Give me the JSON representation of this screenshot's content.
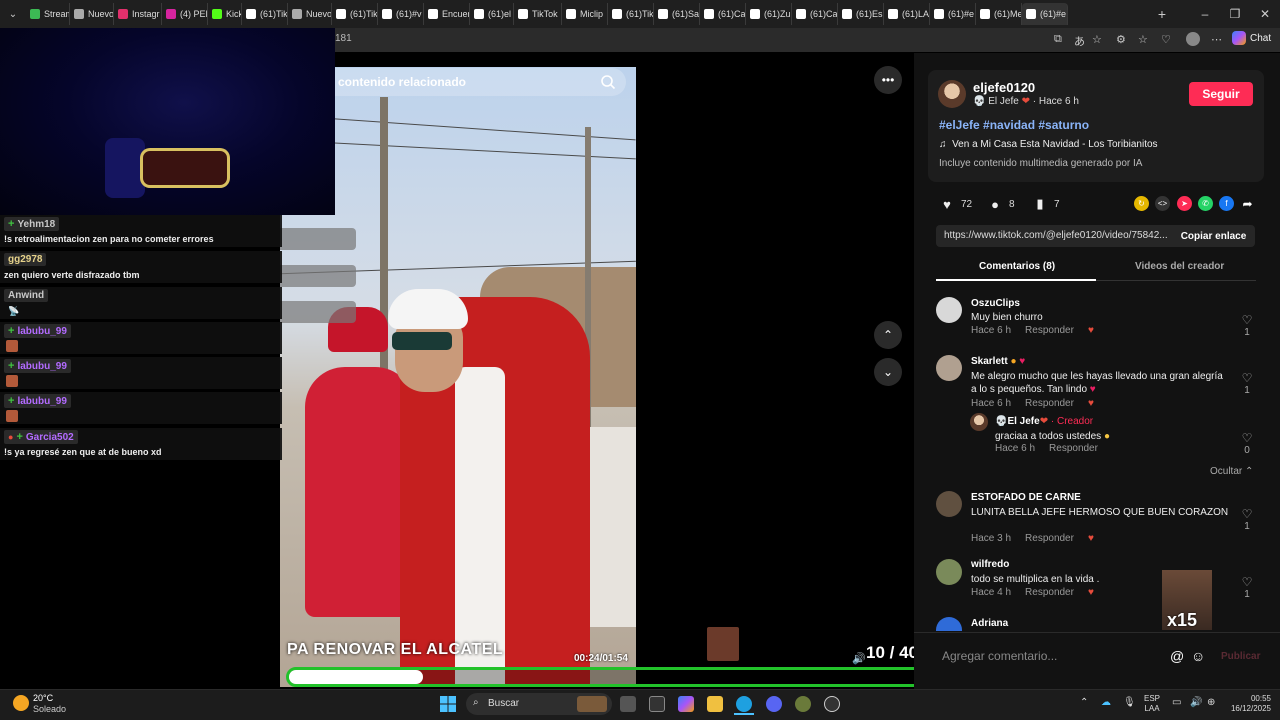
{
  "browser": {
    "tabs": [
      "Stream",
      "Nuevo",
      "Instagr",
      "(4) PER",
      "Kick",
      "(61)Tik",
      "Nuevo",
      "(61)Tik",
      "(61)#v",
      "Encuer",
      "(61)el",
      "TikTok",
      "Miclip",
      "(61)Tik",
      "(61)Sa",
      "(61)Ca",
      "(61)Zu",
      "(61)Ca",
      "(61)Es",
      "(61)LA",
      "(61)#e",
      "(61)Me",
      "(61)#e"
    ],
    "tab_colors": [
      "#3cba54",
      "#aaaaaa",
      "#e1306c",
      "#d6249f",
      "#53fc18",
      "#ffffff",
      "#aaaaaa",
      "#ffffff",
      "#ffffff",
      "#ffffff",
      "#ffffff",
      "#ffffff",
      "#ffffff",
      "#ffffff",
      "#ffffff",
      "#ffffff",
      "#ffffff",
      "#ffffff",
      "#ffffff",
      "#ffffff",
      "#ffffff",
      "#ffffff",
      "#ffffff"
    ],
    "address_fragment": "181",
    "chat_button": "Chat"
  },
  "stream_chat": {
    "messages": [
      {
        "user": "Yehm18",
        "user_color": "#c8c8c8",
        "badge": "+",
        "text": "!s retroalimentacion zen para no cometer errores"
      },
      {
        "user": "gg2978",
        "user_color": "#e6d28a",
        "badge": "",
        "text": "zen quiero verte disfrazado tbm"
      },
      {
        "user": "Anwind",
        "user_color": "#c8c8c8",
        "badge": "",
        "text": ""
      },
      {
        "user": "labubu_99",
        "user_color": "#b36bff",
        "badge": "+",
        "text": ""
      },
      {
        "user": "labubu_99",
        "user_color": "#b36bff",
        "badge": "+",
        "text": ""
      },
      {
        "user": "labubu_99",
        "user_color": "#b36bff",
        "badge": "+",
        "text": ""
      },
      {
        "user": "Garcia502",
        "user_color": "#b36bff",
        "badge": "+",
        "text": "!s ya regresé zen que at de bueno xd"
      }
    ]
  },
  "video": {
    "search_placeholder": "contenido relacionado",
    "caption": "PA RENOVAR EL ALCATEL",
    "time": "00:24/01:54",
    "progress": 0.21,
    "counter": "10 / 40"
  },
  "post": {
    "username": "eljefe0120",
    "display_name": "El Jefe",
    "posted": "· Hace 6 h",
    "follow_label": "Seguir",
    "hashtags": "#elJefe #navidad #saturno",
    "music": "Ven a Mi Casa Esta Navidad - Los Toribianitos",
    "ai_note": "Incluye contenido multimedia generado por IA",
    "likes": "72",
    "comments": "8",
    "saves": "7",
    "link": "https://www.tiktok.com/@eljefe0120/video/75842...",
    "copy_link_label": "Copiar enlace",
    "accent": "#fe2c55"
  },
  "tabs": {
    "comments": "Comentarios (8)",
    "creator_videos": "Videos del creador"
  },
  "comments": [
    {
      "user": "OszuClips",
      "text": "Muy bien churro",
      "time": "Hace 6 h",
      "reply": "Responder",
      "likes": "1"
    },
    {
      "user": "Skarlett",
      "text": "Me alegro mucho que les hayas llevado una gran alegría a lo s pequeños. Tan lindo",
      "time": "Hace 6 h",
      "reply": "Responder",
      "likes": "1"
    },
    {
      "user": "El Jefe",
      "creator_tag": "· Creador",
      "text": "graciaa a todos ustedes",
      "time": "Hace 6 h",
      "reply": "Responder",
      "likes": "0"
    },
    {
      "user": "ESTOFADO DE CARNE",
      "text": "LUNITA BELLA  JEFE HERMOSO QUE BUEN CORAZON",
      "time": "Hace 3 h",
      "reply": "Responder",
      "likes": "1"
    },
    {
      "user": "wilfredo",
      "text": "todo se multiplica en la vida .",
      "time": "Hace 4 h",
      "reply": "Responder",
      "likes": "1"
    },
    {
      "user": "Adriana",
      "text": "",
      "time": "",
      "reply": "",
      "likes": ""
    }
  ],
  "hide_label": "Ocultar",
  "x15": "x15",
  "comment_input": {
    "placeholder": "Agregar comentario...",
    "publish_label": "Publicar"
  },
  "taskbar": {
    "temp": "20°C",
    "weather": "Soleado",
    "search": "Buscar",
    "lang_top": "ESP",
    "lang_bottom": "LAA",
    "time": "00:55",
    "date": "16/12/2025"
  }
}
